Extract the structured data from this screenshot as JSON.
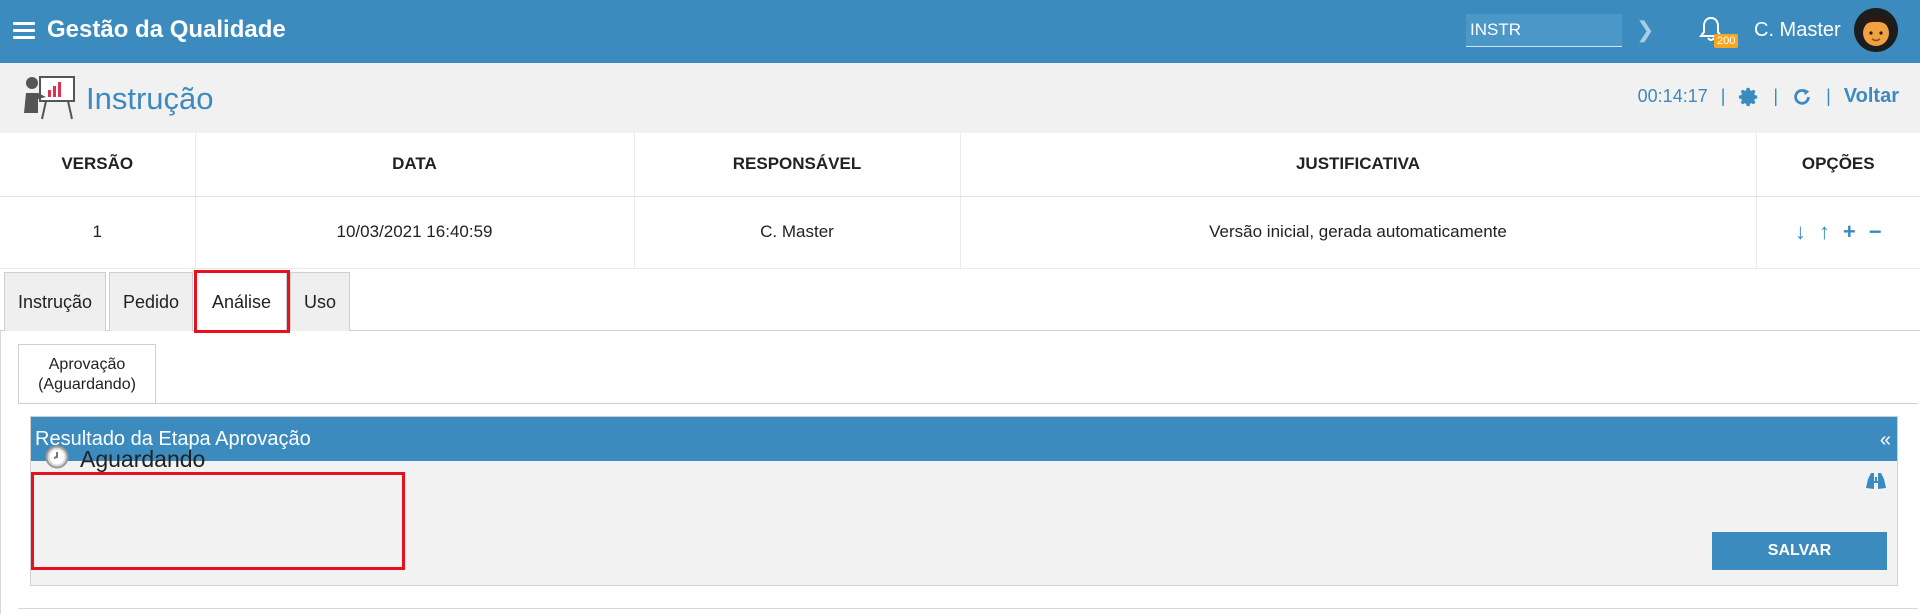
{
  "app": {
    "title": "Gestão da Qualidade"
  },
  "topbar": {
    "search_value": "INSTR",
    "notification_count": "200",
    "user_name": "C. Master"
  },
  "page": {
    "title": "Instrução",
    "timer": "00:14:17",
    "back_label": "Voltar"
  },
  "versions": {
    "headers": [
      "VERSÃO",
      "DATA",
      "RESPONSÁVEL",
      "JUSTIFICATIVA",
      "OPÇÕES"
    ],
    "rows": [
      {
        "version": "1",
        "date": "10/03/2021 16:40:59",
        "responsible": "C. Master",
        "justification": "Versão inicial, gerada automaticamente"
      }
    ]
  },
  "tabs": [
    "Instrução",
    "Pedido",
    "Análise",
    "Uso"
  ],
  "active_tab": "Análise",
  "subtab": {
    "line1": "Aprovação",
    "line2": "(Aguardando)"
  },
  "panel": {
    "title": "Resultado da Etapa Aprovação",
    "collapse": "«",
    "status": "Aguardando",
    "save_label": "SALVAR"
  },
  "colors": {
    "primary": "#3b8bbf",
    "highlight": "#e8101c",
    "badge": "#f5a623"
  },
  "icons": [
    "menu-icon",
    "chevron-right-icon",
    "bell-icon",
    "presentation-icon",
    "gear-icon",
    "refresh-icon",
    "arrow-down-icon",
    "arrow-up-icon",
    "plus-icon",
    "minus-icon",
    "clock-icon",
    "binoculars-icon"
  ]
}
